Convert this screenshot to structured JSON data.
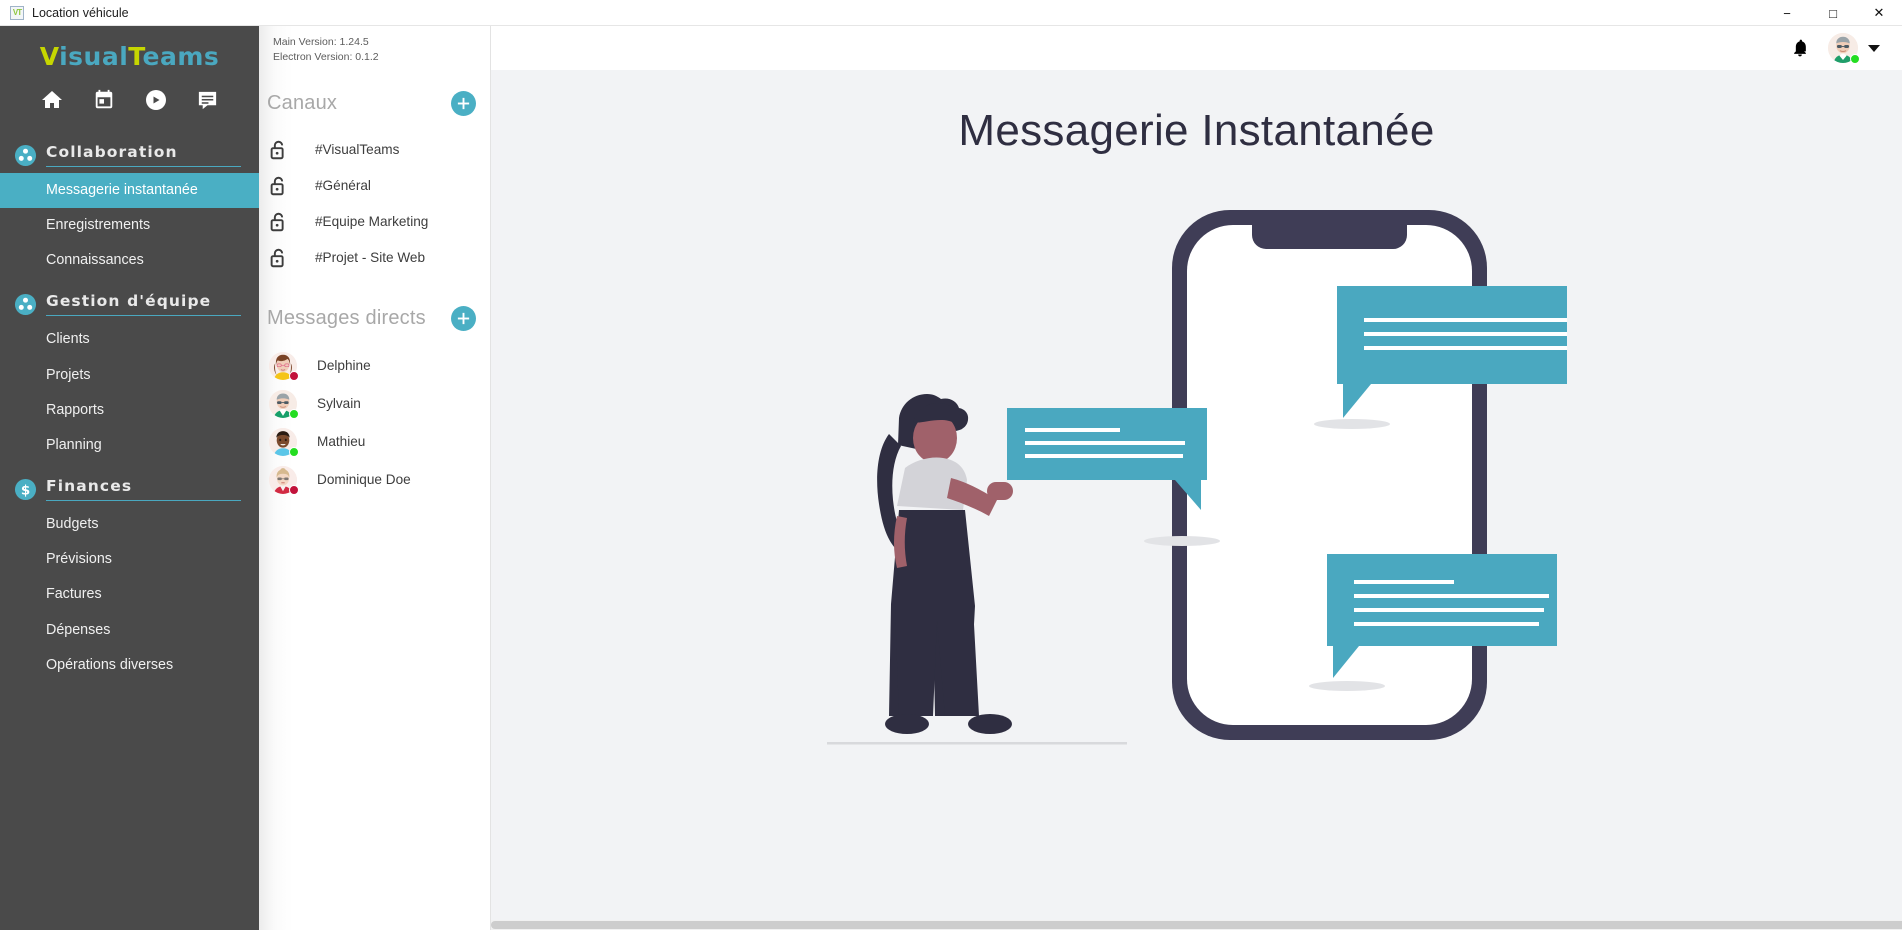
{
  "window": {
    "title": "Location véhicule",
    "app_icon": "VT",
    "minimize": "−",
    "maximize": "□",
    "close": "✕"
  },
  "brand": {
    "logo_part1": "V",
    "logo_part2": "isual",
    "logo_part3": "T",
    "logo_part4": "eams",
    "accent_yellow": "#c6d600",
    "accent_teal": "#4aa8c0"
  },
  "quick_nav": [
    {
      "name": "home-icon",
      "label": "Accueil"
    },
    {
      "name": "calendar-icon",
      "label": "Calendrier"
    },
    {
      "name": "video-icon",
      "label": "Visioconférence"
    },
    {
      "name": "chat-icon",
      "label": "Messagerie"
    }
  ],
  "sidebar": {
    "sections": [
      {
        "title": "Collaboration",
        "icon": "people-icon",
        "items": [
          {
            "label": "Messagerie instantanée",
            "active": true
          },
          {
            "label": "Enregistrements",
            "active": false
          },
          {
            "label": "Connaissances",
            "active": false
          }
        ]
      },
      {
        "title": "Gestion d'équipe",
        "icon": "people-icon",
        "items": [
          {
            "label": "Clients",
            "active": false
          },
          {
            "label": "Projets",
            "active": false
          },
          {
            "label": "Rapports",
            "active": false
          },
          {
            "label": "Planning",
            "active": false
          }
        ]
      },
      {
        "title": "Finances",
        "icon": "dollar-icon",
        "items": [
          {
            "label": "Budgets",
            "active": false
          },
          {
            "label": "Prévisions",
            "active": false
          },
          {
            "label": "Factures",
            "active": false
          },
          {
            "label": "Dépenses",
            "active": false
          },
          {
            "label": "Opérations diverses",
            "active": false
          }
        ]
      }
    ]
  },
  "versions": {
    "main": "Main Version: 1.24.5",
    "electron": "Electron Version: 0.1.2"
  },
  "channels": {
    "heading": "Canaux",
    "add_label": "+",
    "items": [
      {
        "name": "#VisualTeams",
        "icon": "unlock-icon"
      },
      {
        "name": "#Général",
        "icon": "unlock-icon"
      },
      {
        "name": "#Equipe Marketing",
        "icon": "unlock-icon"
      },
      {
        "name": "#Projet - Site Web",
        "icon": "unlock-icon"
      }
    ]
  },
  "direct_messages": {
    "heading": "Messages directs",
    "add_label": "+",
    "items": [
      {
        "name": "Delphine",
        "status": "busy",
        "status_color": "#c2123b"
      },
      {
        "name": "Sylvain",
        "status": "online",
        "status_color": "#24dd21"
      },
      {
        "name": "Mathieu",
        "status": "online",
        "status_color": "#24dd21"
      },
      {
        "name": "Dominique Doe",
        "status": "busy",
        "status_color": "#c2123b"
      }
    ]
  },
  "header": {
    "notifications_icon": "bell-icon",
    "user_status": "online",
    "dropdown_icon": "chevron-down-icon"
  },
  "main": {
    "page_title": "Messagerie Instantanée",
    "illustration": "messaging-illustration",
    "background": "#f2f3f5",
    "bubble_color": "#4aa8c0",
    "figure_color": "#2f2e41"
  }
}
